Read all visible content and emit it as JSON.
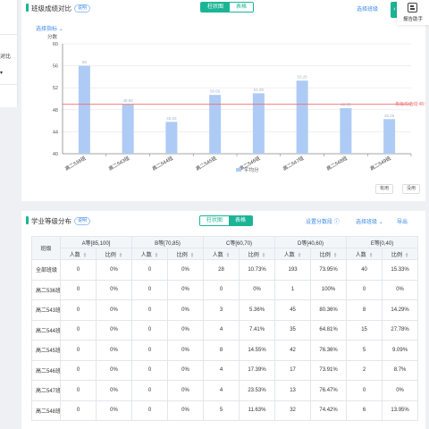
{
  "left_panel": {
    "items": [
      "对比",
      "▾"
    ]
  },
  "assistant": {
    "label": "报告助手",
    "arrow": "‹"
  },
  "bar_section": {
    "title": "班级成绩对比",
    "help": "说明",
    "tabs": [
      "柱状图",
      "表格"
    ],
    "active_tab": 0,
    "select_class": "选择班级",
    "select_metric": "选择指标",
    "buttons": [
      "有用",
      "没用"
    ],
    "colors": {
      "bar": "#aecbf6",
      "avg_line": "#f06b6b",
      "accent": "#1bb595"
    }
  },
  "chart_data": {
    "type": "bar",
    "ylabel": "分数",
    "ylim": [
      40,
      60
    ],
    "yticks": [
      40,
      44,
      48,
      52,
      56,
      60
    ],
    "categories": [
      "高二536班",
      "高二543班",
      "高二544班",
      "高二545班",
      "高二546班",
      "高二547班",
      "高二548班",
      "高二549班"
    ],
    "series": [
      {
        "name": "平均分",
        "values": [
          56,
          49,
          45.8,
          50.7,
          51,
          53.3,
          48.3,
          46.3
        ]
      }
    ],
    "data_labels": [
      "56",
      "48.96",
      "45.83",
      "50.65",
      "51.00",
      "53.25",
      "48.35",
      "46.26"
    ],
    "reference_line": {
      "label": "年级均值线:48.99",
      "value": 48.99
    },
    "legend": "bottom",
    "grid": true
  },
  "table_section": {
    "title": "学业等级分布",
    "help": "说明",
    "tabs": [
      "柱状图",
      "表格"
    ],
    "active_tab": 1,
    "score_range": "设置分数段",
    "select_class": "选择班级",
    "export": "导出",
    "class_header": "班级",
    "grade_headers": [
      "A等[85,100]",
      "B等[70,85)",
      "C等[60,70)",
      "D等[40,60)",
      "E等[0,40)"
    ],
    "sub_headers": [
      "人数",
      "比例"
    ],
    "rows": [
      {
        "name": "全部班级",
        "cells": [
          "0",
          "0%",
          "0",
          "0%",
          "28",
          "10.73%",
          "193",
          "73.95%",
          "40",
          "15.33%"
        ]
      },
      {
        "name": "高二536班",
        "cells": [
          "0",
          "0%",
          "0",
          "0%",
          "0",
          "0%",
          "1",
          "100%",
          "0",
          "0%"
        ]
      },
      {
        "name": "高二543班",
        "cells": [
          "0",
          "0%",
          "0",
          "0%",
          "3",
          "5.36%",
          "45",
          "80.36%",
          "8",
          "14.29%"
        ]
      },
      {
        "name": "高二544班",
        "cells": [
          "0",
          "0%",
          "0",
          "0%",
          "4",
          "7.41%",
          "35",
          "64.81%",
          "15",
          "27.78%"
        ]
      },
      {
        "name": "高二545班",
        "cells": [
          "0",
          "0%",
          "0",
          "0%",
          "8",
          "14.55%",
          "42",
          "76.36%",
          "5",
          "9.09%"
        ]
      },
      {
        "name": "高二546班",
        "cells": [
          "0",
          "0%",
          "0",
          "0%",
          "4",
          "17.39%",
          "17",
          "73.91%",
          "2",
          "8.7%"
        ]
      },
      {
        "name": "高二547班",
        "cells": [
          "0",
          "0%",
          "0",
          "0%",
          "4",
          "23.53%",
          "13",
          "76.47%",
          "0",
          "0%"
        ]
      },
      {
        "name": "高二548班",
        "cells": [
          "0",
          "0%",
          "0",
          "0%",
          "5",
          "11.63%",
          "32",
          "74.42%",
          "6",
          "13.95%"
        ]
      }
    ]
  }
}
